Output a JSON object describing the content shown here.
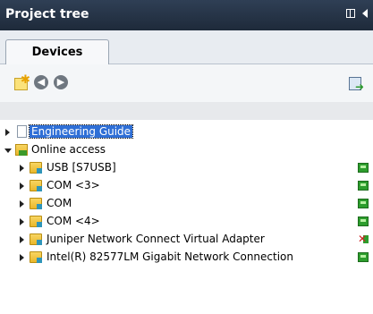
{
  "panel": {
    "title": "Project tree"
  },
  "tabs": [
    {
      "label": "Devices",
      "active": true
    }
  ],
  "toolbar": {
    "icons": [
      "add-device-icon",
      "back-icon",
      "forward-icon",
      "show-view-icon"
    ]
  },
  "tree": {
    "items": [
      {
        "label": "Engineering Guide",
        "icon": "document-icon",
        "expander": "collapsed",
        "selected": true,
        "indent": 0
      },
      {
        "label": "Online access",
        "icon": "online-access-icon",
        "expander": "expanded",
        "indent": 0
      },
      {
        "label": "USB [S7USB]",
        "icon": "interface-folder-icon",
        "expander": "collapsed",
        "status": "connected",
        "indent": 1
      },
      {
        "label": "COM <3>",
        "icon": "interface-folder-icon",
        "expander": "collapsed",
        "status": "connected",
        "indent": 1
      },
      {
        "label": "COM",
        "icon": "interface-folder-icon",
        "expander": "collapsed",
        "status": "connected",
        "indent": 1
      },
      {
        "label": "COM <4>",
        "icon": "interface-folder-icon",
        "expander": "collapsed",
        "status": "connected",
        "indent": 1
      },
      {
        "label": "Juniper Network Connect Virtual Adapter",
        "icon": "interface-folder-icon",
        "expander": "collapsed",
        "status": "disconnected",
        "indent": 1
      },
      {
        "label": "Intel(R) 82577LM Gigabit Network Connection",
        "icon": "interface-folder-icon",
        "expander": "collapsed",
        "status": "connected",
        "indent": 1
      }
    ]
  },
  "colors": {
    "titlebar": "#24324a",
    "selection": "#2f6fd6",
    "status_ok": "#2d9d2d"
  }
}
